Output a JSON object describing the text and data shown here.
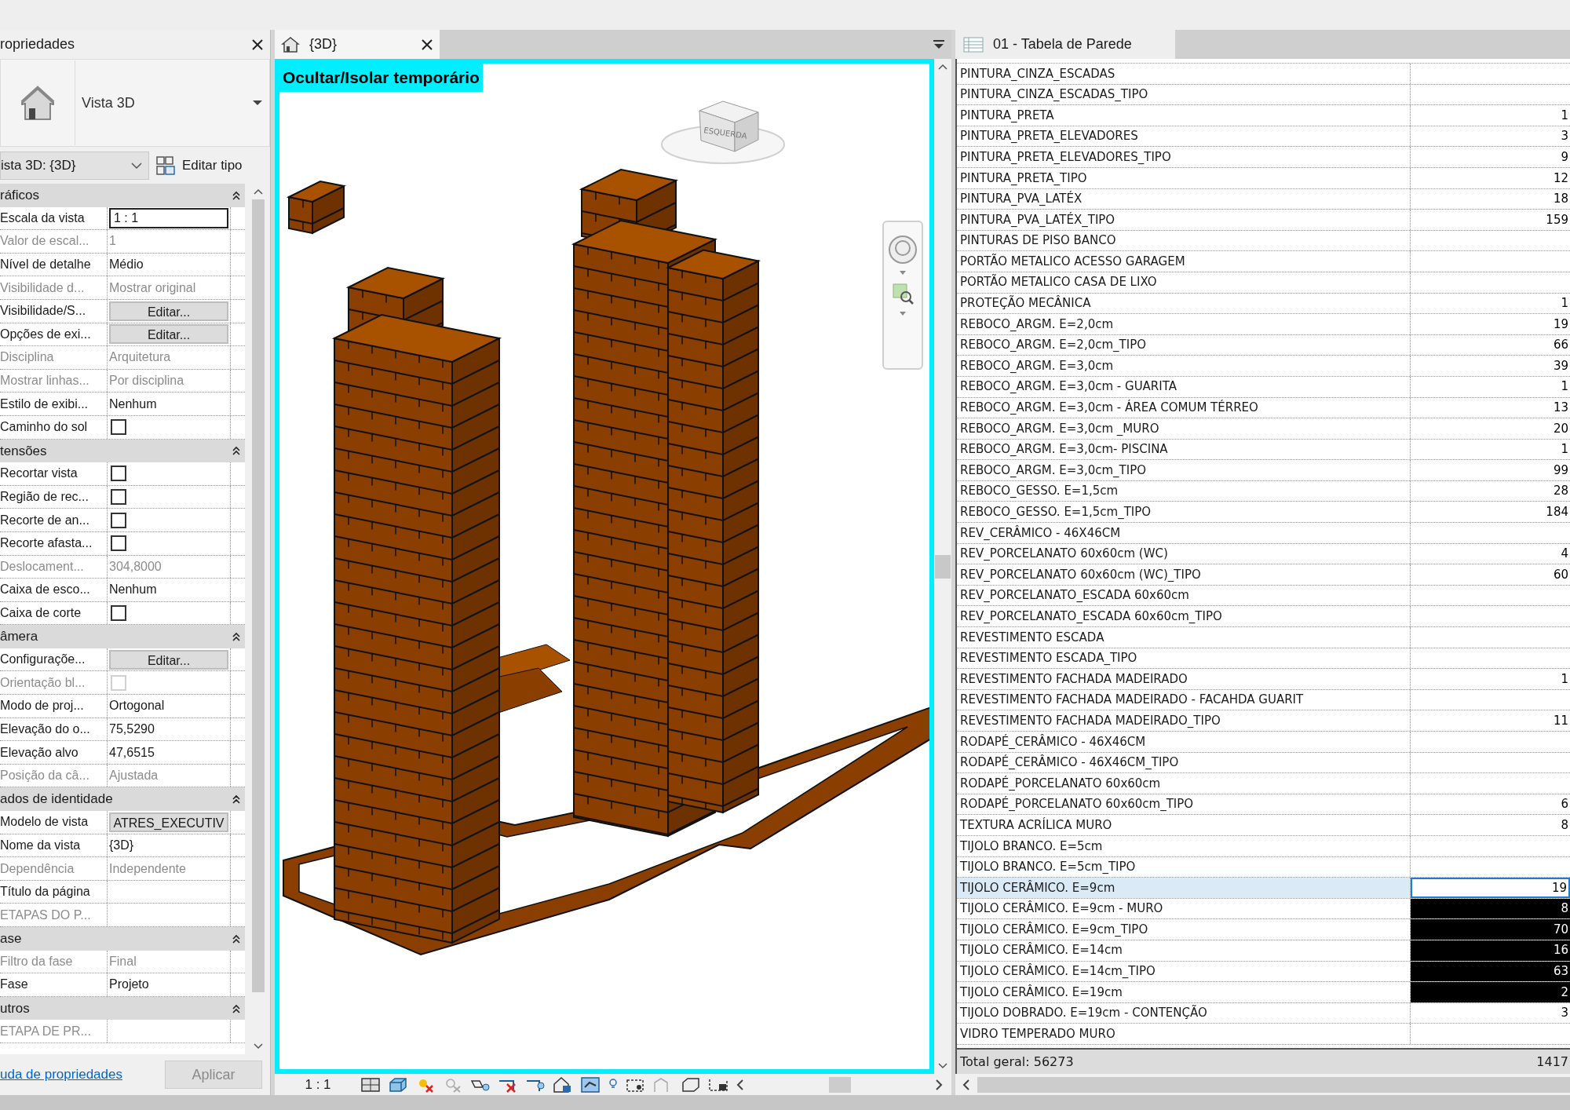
{
  "properties": {
    "title": "ropriedades",
    "type_name": "Vista 3D",
    "instance_selector": "ista 3D: {3D}",
    "edit_type": "Editar tipo",
    "groups": [
      {
        "title": "ráficos",
        "rows": [
          {
            "label": "Escala da vista",
            "value": "1 : 1",
            "kind": "field",
            "disabled": false
          },
          {
            "label": "Valor de escal...",
            "value": "1",
            "kind": "text",
            "disabled": true
          },
          {
            "label": "Nível de detalhe",
            "value": "Médio",
            "kind": "text",
            "disabled": false
          },
          {
            "label": "Visibilidade d...",
            "value": "Mostrar original",
            "kind": "text",
            "disabled": true
          },
          {
            "label": "Visibilidade/S...",
            "value": "Editar...",
            "kind": "button",
            "disabled": false
          },
          {
            "label": "Opções de exi...",
            "value": "Editar...",
            "kind": "button",
            "disabled": false
          },
          {
            "label": "Disciplina",
            "value": "Arquitetura",
            "kind": "text",
            "disabled": true
          },
          {
            "label": "Mostrar linhas...",
            "value": "Por disciplina",
            "kind": "text",
            "disabled": true
          },
          {
            "label": "Estilo de exibi...",
            "value": "Nenhum",
            "kind": "text",
            "disabled": false
          },
          {
            "label": "Caminho do sol",
            "kind": "checkbox",
            "checked": false,
            "disabled": false
          }
        ]
      },
      {
        "title": "tensões",
        "rows": [
          {
            "label": "Recortar vista",
            "kind": "checkbox",
            "checked": false,
            "disabled": false
          },
          {
            "label": "Região de rec...",
            "kind": "checkbox",
            "checked": false,
            "disabled": false
          },
          {
            "label": "Recorte de an...",
            "kind": "checkbox",
            "checked": false,
            "disabled": false
          },
          {
            "label": "Recorte afasta...",
            "kind": "checkbox",
            "checked": false,
            "disabled": false
          },
          {
            "label": "Deslocament...",
            "value": "304,8000",
            "kind": "text",
            "disabled": true
          },
          {
            "label": "Caixa de esco...",
            "value": "Nenhum",
            "kind": "text",
            "disabled": false
          },
          {
            "label": "Caixa de corte",
            "kind": "checkbox",
            "checked": false,
            "disabled": false
          }
        ]
      },
      {
        "title": "âmera",
        "rows": [
          {
            "label": "Configuraçõe...",
            "value": "Editar...",
            "kind": "button",
            "disabled": false
          },
          {
            "label": "Orientação bl...",
            "kind": "checkbox",
            "checked": false,
            "disabled": true
          },
          {
            "label": "Modo de proj...",
            "value": "Ortogonal",
            "kind": "text",
            "disabled": false
          },
          {
            "label": "Elevação do o...",
            "value": "75,5290",
            "kind": "text",
            "disabled": false
          },
          {
            "label": "Elevação alvo",
            "value": "47,6515",
            "kind": "text",
            "disabled": false
          },
          {
            "label": "Posição da câ...",
            "value": "Ajustada",
            "kind": "text",
            "disabled": true
          }
        ]
      },
      {
        "title": "ados de identidade",
        "rows": [
          {
            "label": "Modelo de vista",
            "value": "ATRES_EXECUTIV",
            "kind": "button",
            "disabled": false
          },
          {
            "label": "Nome da vista",
            "value": "{3D}",
            "kind": "text",
            "disabled": false
          },
          {
            "label": "Dependência",
            "value": "Independente",
            "kind": "text",
            "disabled": true
          },
          {
            "label": "Título da página",
            "kind": "text",
            "disabled": false
          },
          {
            "label": "ETAPAS DO P...",
            "kind": "text",
            "disabled": true
          }
        ]
      },
      {
        "title": "ase",
        "rows": [
          {
            "label": "Filtro da fase",
            "value": "Final",
            "kind": "text",
            "disabled": true
          },
          {
            "label": "Fase",
            "value": "Projeto",
            "kind": "text",
            "disabled": false
          }
        ]
      },
      {
        "title": "utros",
        "rows": [
          {
            "label": "ETAPA DE PR...",
            "kind": "text",
            "disabled": true
          }
        ]
      }
    ],
    "help_link": "uda de propriedades",
    "apply": {
      "label": "Aplicar",
      "disabled": true
    }
  },
  "view": {
    "tab": "{3D}",
    "banner": "Ocultar/Isolar temporário",
    "view_cube_label": "ESQUERDA",
    "scale": "1 : 1"
  },
  "schedule": {
    "tab": "01 - Tabela de Parede",
    "rows": [
      {
        "name": "PINTURA_CINZA_ESCADAS",
        "selected": false,
        "active": false
      },
      {
        "name": "PINTURA_CINZA_ESCADAS_TIPO",
        "selected": false,
        "active": false
      },
      {
        "name": "PINTURA_PRETA",
        "value": "1",
        "selected": false,
        "active": false
      },
      {
        "name": "PINTURA_PRETA_ELEVADORES",
        "value": "3",
        "selected": false,
        "active": false
      },
      {
        "name": "PINTURA_PRETA_ELEVADORES_TIPO",
        "value": "9",
        "selected": false,
        "active": false
      },
      {
        "name": "PINTURA_PRETA_TIPO",
        "value": "12",
        "selected": false,
        "active": false
      },
      {
        "name": "PINTURA_PVA_LATÉX",
        "value": "18",
        "selected": false,
        "active": false
      },
      {
        "name": "PINTURA_PVA_LATÉX_TIPO",
        "value": "159",
        "selected": false,
        "active": false
      },
      {
        "name": "PINTURAS DE PISO BANCO",
        "selected": false,
        "active": false
      },
      {
        "name": "PORTÃO METALICO ACESSO GARAGEM",
        "selected": false,
        "active": false
      },
      {
        "name": "PORTÃO METALICO CASA DE LIXO",
        "selected": false,
        "active": false
      },
      {
        "name": "PROTEÇÃO MECÂNICA",
        "value": "1",
        "selected": false,
        "active": false
      },
      {
        "name": "REBOCO_ARGM. E=2,0cm",
        "value": "19",
        "selected": false,
        "active": false
      },
      {
        "name": "REBOCO_ARGM. E=2,0cm_TIPO",
        "value": "66",
        "selected": false,
        "active": false
      },
      {
        "name": "REBOCO_ARGM. E=3,0cm",
        "value": "39",
        "selected": false,
        "active": false
      },
      {
        "name": "REBOCO_ARGM. E=3,0cm - GUARITA",
        "value": "1",
        "selected": false,
        "active": false
      },
      {
        "name": "REBOCO_ARGM. E=3,0cm - ÁREA COMUM TÉRREO",
        "value": "13",
        "selected": false,
        "active": false
      },
      {
        "name": "REBOCO_ARGM. E=3,0cm _MURO",
        "value": "20",
        "selected": false,
        "active": false
      },
      {
        "name": "REBOCO_ARGM. E=3,0cm- PISCINA",
        "value": "1",
        "selected": false,
        "active": false
      },
      {
        "name": "REBOCO_ARGM. E=3,0cm_TIPO",
        "value": "99",
        "selected": false,
        "active": false
      },
      {
        "name": "REBOCO_GESSO. E=1,5cm",
        "value": "28",
        "selected": false,
        "active": false
      },
      {
        "name": "REBOCO_GESSO. E=1,5cm_TIPO",
        "value": "184",
        "selected": false,
        "active": false
      },
      {
        "name": "REV_CERÂMICO - 46X46CM",
        "selected": false,
        "active": false
      },
      {
        "name": "REV_PORCELANATO 60x60cm (WC)",
        "value": "4",
        "selected": false,
        "active": false
      },
      {
        "name": "REV_PORCELANATO 60x60cm (WC)_TIPO",
        "value": "60",
        "selected": false,
        "active": false
      },
      {
        "name": "REV_PORCELANATO_ESCADA 60x60cm",
        "selected": false,
        "active": false
      },
      {
        "name": "REV_PORCELANATO_ESCADA 60x60cm_TIPO",
        "selected": false,
        "active": false
      },
      {
        "name": "REVESTIMENTO ESCADA",
        "selected": false,
        "active": false
      },
      {
        "name": "REVESTIMENTO ESCADA_TIPO",
        "selected": false,
        "active": false
      },
      {
        "name": "REVESTIMENTO FACHADA MADEIRADO",
        "value": "1",
        "selected": false,
        "active": false
      },
      {
        "name": "REVESTIMENTO FACHADA MADEIRADO - FACAHDA GUARIT",
        "selected": false,
        "active": false
      },
      {
        "name": "REVESTIMENTO FACHADA MADEIRADO_TIPO",
        "value": "11",
        "selected": false,
        "active": false
      },
      {
        "name": "RODAPÉ_CERÂMICO - 46X46CM",
        "selected": false,
        "active": false
      },
      {
        "name": "RODAPÉ_CERÂMICO - 46X46CM_TIPO",
        "selected": false,
        "active": false
      },
      {
        "name": "RODAPÉ_PORCELANATO 60x60cm",
        "selected": false,
        "active": false
      },
      {
        "name": "RODAPÉ_PORCELANATO 60x60cm_TIPO",
        "value": "6",
        "selected": false,
        "active": false
      },
      {
        "name": "TEXTURA ACRÍLICA MURO",
        "value": "8",
        "selected": false,
        "active": false
      },
      {
        "name": "TIJOLO BRANCO. E=5cm",
        "selected": false,
        "active": false
      },
      {
        "name": "TIJOLO BRANCO. E=5cm_TIPO",
        "selected": false,
        "active": false
      },
      {
        "name": "TIJOLO CERÂMICO. E=9cm",
        "value": "19",
        "selected": false,
        "active": true
      },
      {
        "name": "TIJOLO CERÂMICO. E=9cm - MURO",
        "value": "8",
        "selected": true,
        "active": false
      },
      {
        "name": "TIJOLO CERÂMICO. E=9cm_TIPO",
        "value": "70",
        "selected": true,
        "active": false
      },
      {
        "name": "TIJOLO CERÂMICO. E=14cm",
        "value": "16",
        "selected": true,
        "active": false
      },
      {
        "name": "TIJOLO CERÂMICO. E=14cm_TIPO",
        "value": "63",
        "selected": true,
        "active": false
      },
      {
        "name": "TIJOLO CERÂMICO. E=19cm",
        "value": "2",
        "selected": true,
        "active": false
      },
      {
        "name": "TIJOLO DOBRADO. E=19cm - CONTENÇÃO",
        "value": "3",
        "selected": false,
        "active": false
      },
      {
        "name": "VIDRO TEMPERADO MURO",
        "selected": false,
        "active": false
      }
    ],
    "total_label": "Total geral: 56273",
    "total_value": "1417"
  }
}
